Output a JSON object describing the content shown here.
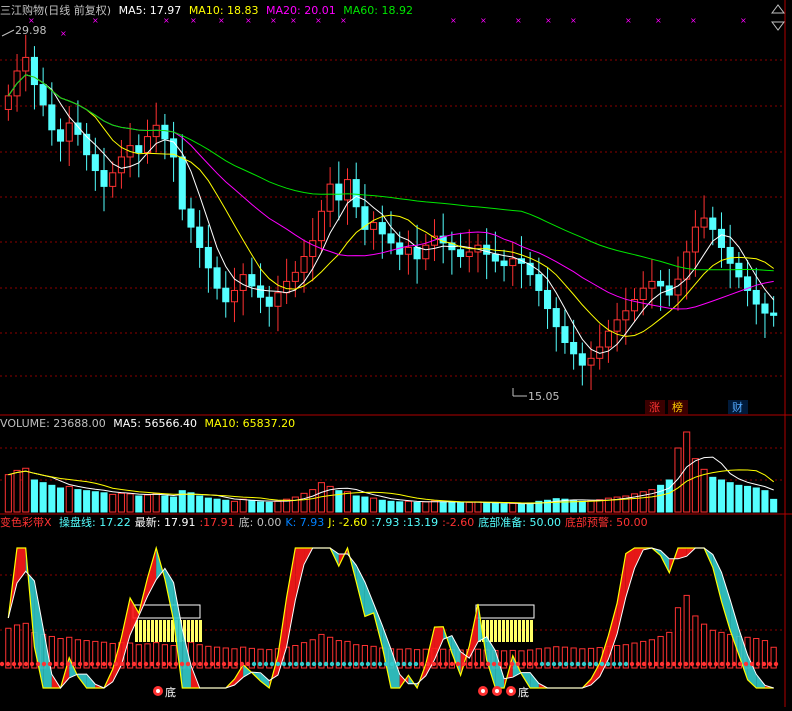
{
  "colors": {
    "up": "#ff3232",
    "down": "#54ffff",
    "ma5": "#ffffff",
    "ma10": "#ffff00",
    "ma20": "#ff00ff",
    "ma60": "#00e600",
    "grid": "#8b0000",
    "text": "#c0c0c0"
  },
  "price_panel": {
    "title": "三江购物(日线 前复权)",
    "ma5_label": "MA5: 17.97",
    "ma10_label": "MA10: 18.83",
    "ma20_label": "MA20: 20.01",
    "ma60_label": "MA60: 18.92",
    "high_label": "29.98",
    "low_label": "15.05",
    "markers": [
      "涨",
      "榜",
      "财"
    ]
  },
  "volume_panel": {
    "vol_label": "VOLUME: 23688.00",
    "ma5_label": "MA5: 56566.40",
    "ma10_label": "MA10: 65837.20"
  },
  "indicator_panel": {
    "name": "变色彩带X",
    "items": [
      {
        "label": "操盘线: 17.22",
        "color": "#54ffff"
      },
      {
        "label": "最新: 17.91",
        "color": "#ffffff"
      },
      {
        "label": ":17.91",
        "color": "#ff3232"
      },
      {
        "label": "底: 0.00",
        "color": "#c0c0c0"
      },
      {
        "label": "K: 7.93",
        "color": "#0080ff"
      },
      {
        "label": "J: -2.60",
        "color": "#ffff00"
      },
      {
        "label": ":7.93 :13.19",
        "color": "#54ffff"
      },
      {
        "label": ":-2.60",
        "color": "#ff3232"
      },
      {
        "label": "底部准备: 50.00",
        "color": "#54ffff"
      },
      {
        "label": "底部预警: 50.00",
        "color": "#ff3232"
      }
    ],
    "bottom_markers": [
      "底",
      "底"
    ]
  },
  "chart_data": {
    "type": "candlestick",
    "high": 29.98,
    "low": 15.05,
    "ohlc_close": [
      27.5,
      28.6,
      29.2,
      28.0,
      27.1,
      26.0,
      25.5,
      26.3,
      25.8,
      24.9,
      24.2,
      23.5,
      24.1,
      24.8,
      25.3,
      25.0,
      25.7,
      26.2,
      25.6,
      24.8,
      22.5,
      21.7,
      20.8,
      19.9,
      19.0,
      18.4,
      18.9,
      19.6,
      19.1,
      18.6,
      18.2,
      18.8,
      19.3,
      19.7,
      20.4,
      21.1,
      22.4,
      23.6,
      22.9,
      23.8,
      22.6,
      21.6,
      21.9,
      21.4,
      21.0,
      20.5,
      20.8,
      20.3,
      20.9,
      21.3,
      21.0,
      20.7,
      20.4,
      20.6,
      20.9,
      20.5,
      20.2,
      20.0,
      20.3,
      20.1,
      19.6,
      18.9,
      18.1,
      17.3,
      16.6,
      16.1,
      15.6,
      15.9,
      16.4,
      17.1,
      17.6,
      18.0,
      18.5,
      19.0,
      19.3,
      19.1,
      18.7,
      19.4,
      20.6,
      21.7,
      22.1,
      21.6,
      20.8,
      20.1,
      19.5,
      18.9,
      18.3,
      17.9,
      17.8
    ],
    "volume": [
      70000,
      78000,
      82000,
      60000,
      55000,
      50000,
      45000,
      48000,
      42000,
      40000,
      38000,
      36000,
      33000,
      35000,
      34000,
      30000,
      32000,
      35000,
      30000,
      28000,
      40000,
      36000,
      30000,
      26000,
      24000,
      22000,
      20000,
      24000,
      21000,
      19000,
      18000,
      20000,
      24000,
      28000,
      35000,
      42000,
      55000,
      48000,
      40000,
      38000,
      30000,
      28000,
      26000,
      22000,
      20000,
      19000,
      20000,
      18000,
      19000,
      21000,
      19000,
      18000,
      17000,
      18000,
      19000,
      17000,
      16000,
      15000,
      16000,
      15000,
      17000,
      20000,
      22000,
      25000,
      24000,
      22000,
      20000,
      21000,
      23000,
      26000,
      28000,
      30000,
      34000,
      38000,
      42000,
      50000,
      60000,
      120000,
      150000,
      100000,
      80000,
      65000,
      60000,
      55000,
      50000,
      48000,
      45000,
      40000,
      23688
    ]
  }
}
